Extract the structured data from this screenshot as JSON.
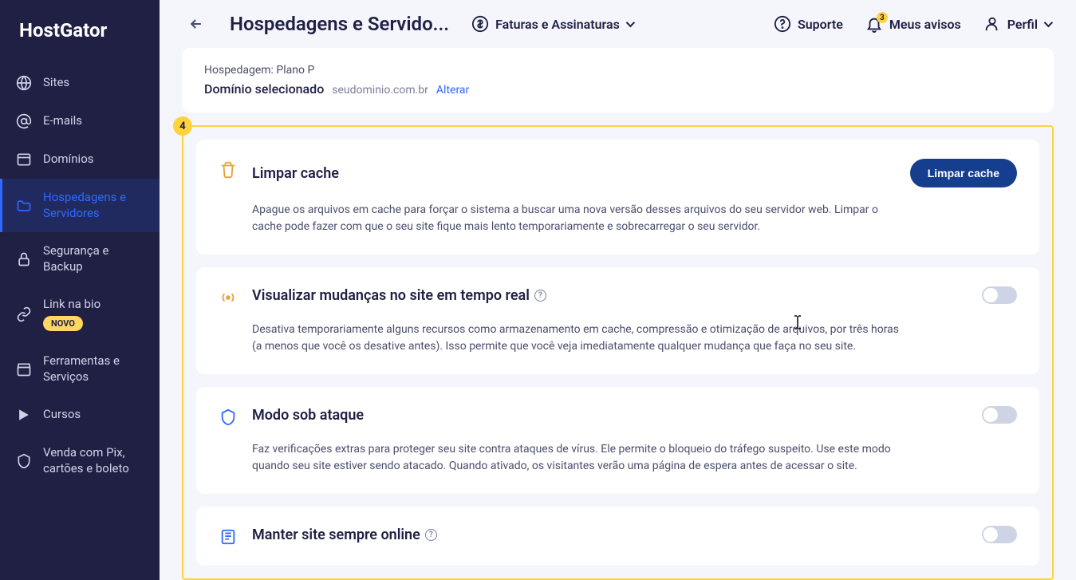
{
  "brand": "HostGator",
  "sidebar": {
    "items": [
      {
        "label": "Sites"
      },
      {
        "label": "E-mails"
      },
      {
        "label": "Domínios"
      },
      {
        "label": "Hospedagens e Servidores"
      },
      {
        "label": "Segurança e Backup"
      },
      {
        "label": "Link na bio",
        "badge": "NOVO"
      },
      {
        "label": "Ferramentas e Serviços"
      },
      {
        "label": "Cursos"
      },
      {
        "label": "Venda com Pix, cartões e boleto"
      }
    ]
  },
  "topbar": {
    "page_title": "Hospedagens e Servido...",
    "invoices": "Faturas e Assinaturas",
    "support": "Suporte",
    "notices": "Meus avisos",
    "notices_count": "3",
    "profile": "Perfil"
  },
  "domain_card": {
    "plan_label": "Hospedagem: Plano P",
    "selected_label": "Domínio selecionado",
    "domain_value": "seudominio.com.br",
    "change": "Alterar"
  },
  "highlight_number": "4",
  "cards": [
    {
      "title": "Limpar cache",
      "button": "Limpar cache",
      "desc": "Apague os arquivos em cache para forçar o sistema a buscar uma nova versão desses arquivos do seu servidor web. Limpar o cache pode fazer com que o seu site fique mais lento temporariamente e sobrecarregar o seu servidor."
    },
    {
      "title": "Visualizar mudanças no site em tempo real",
      "desc": "Desativa temporariamente alguns recursos como armazenamento em cache, compressão e otimização de arquivos, por três horas (a menos que você os desative antes). Isso permite que você veja imediatamente qualquer mudança que faça no seu site."
    },
    {
      "title": "Modo sob ataque",
      "desc": "Faz verificações extras para proteger seu site contra ataques de vírus. Ele permite o bloqueio do tráfego suspeito. Use este modo quando seu site estiver sendo atacado. Quando ativado, os visitantes verão uma página de espera antes de acessar o site."
    },
    {
      "title": "Manter site sempre online",
      "desc": ""
    }
  ]
}
